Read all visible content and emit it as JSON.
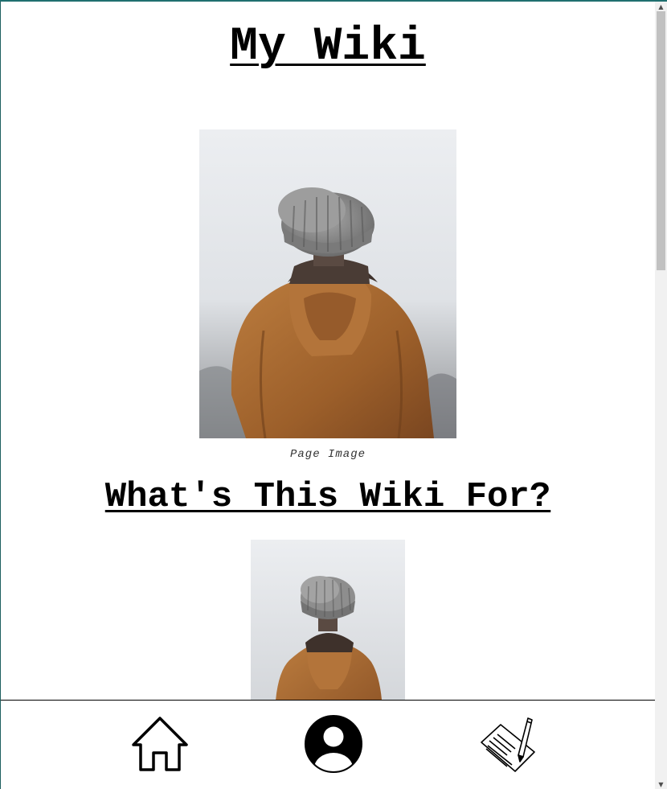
{
  "header": {
    "title": "My Wiki"
  },
  "main": {
    "page_image_caption": "Page Image",
    "section_heading": "What's This Wiki For?"
  },
  "bottom_nav": {
    "items": [
      {
        "icon": "house-icon"
      },
      {
        "icon": "user-profile-icon"
      },
      {
        "icon": "notepad-pencil-icon"
      }
    ]
  },
  "colors": {
    "jacket": "#a86a32",
    "hat": "#8a8a8a",
    "background_fog": "#e9ebee"
  },
  "scrollbar": {
    "up_arrow": "▲",
    "down_arrow": "▼"
  }
}
